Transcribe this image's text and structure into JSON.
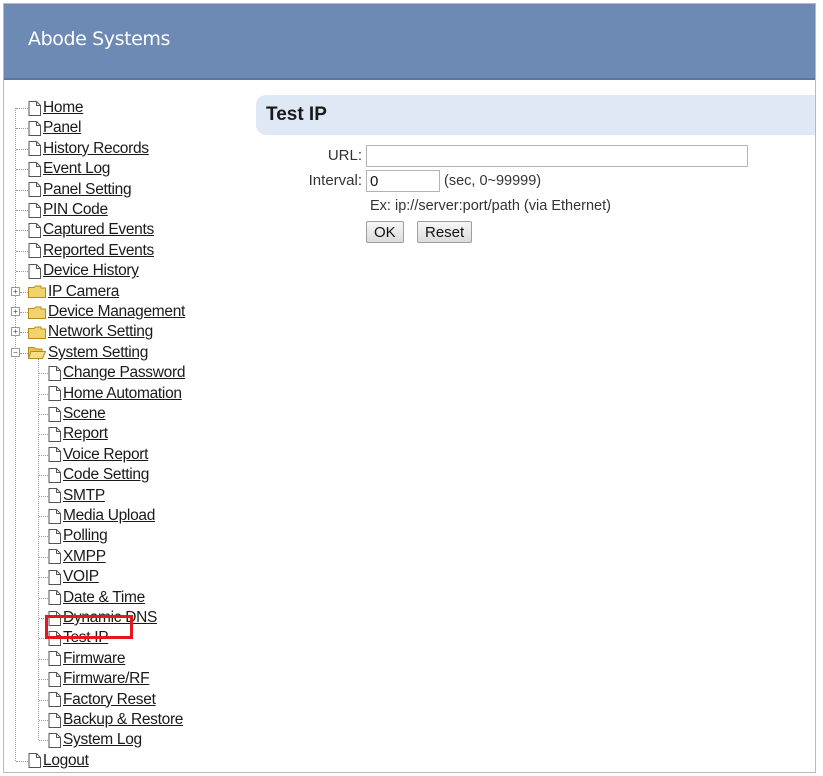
{
  "header": {
    "brand": "Abode Systems"
  },
  "tree": {
    "top": [
      "Home",
      "Panel",
      "History Records",
      "Event Log",
      "Panel Setting",
      "PIN Code",
      "Captured Events",
      "Reported Events",
      "Device History"
    ],
    "folders": [
      {
        "label": "IP Camera",
        "state": "+"
      },
      {
        "label": "Device Management",
        "state": "+"
      },
      {
        "label": "Network Setting",
        "state": "+"
      },
      {
        "label": "System Setting",
        "state": "−"
      }
    ],
    "system_children": [
      "Change Password",
      "Home Automation",
      "Scene",
      "Report",
      "Voice Report",
      "Code Setting",
      "SMTP",
      "Media Upload",
      "Polling",
      "XMPP",
      "VOIP",
      "Date & Time",
      "Dynamic DNS",
      "Test IP",
      "Firmware",
      "Firmware/RF",
      "Factory Reset",
      "Backup & Restore",
      "System Log"
    ],
    "logout": "Logout",
    "selected": "Test IP"
  },
  "main": {
    "title": "Test IP",
    "url_label": "URL:",
    "url_value": "",
    "interval_label": "Interval:",
    "interval_value": "0",
    "interval_hint": "(sec, 0~99999)",
    "example": "Ex: ip://server:port/path (via Ethernet)",
    "ok_label": "OK",
    "reset_label": "Reset"
  },
  "colors": {
    "header": "#6c8ab4",
    "titlebar": "#dfe8f5",
    "highlight": "#e3181c"
  }
}
